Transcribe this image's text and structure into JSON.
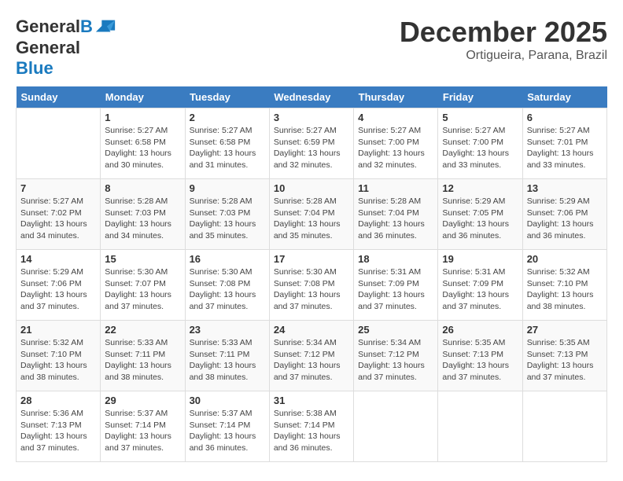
{
  "header": {
    "logo_line1": "General",
    "logo_line2": "Blue",
    "month": "December 2025",
    "location": "Ortigueira, Parana, Brazil"
  },
  "columns": [
    "Sunday",
    "Monday",
    "Tuesday",
    "Wednesday",
    "Thursday",
    "Friday",
    "Saturday"
  ],
  "weeks": [
    [
      {
        "day": "",
        "info": ""
      },
      {
        "day": "1",
        "info": "Sunrise: 5:27 AM\nSunset: 6:58 PM\nDaylight: 13 hours and 30 minutes."
      },
      {
        "day": "2",
        "info": "Sunrise: 5:27 AM\nSunset: 6:58 PM\nDaylight: 13 hours and 31 minutes."
      },
      {
        "day": "3",
        "info": "Sunrise: 5:27 AM\nSunset: 6:59 PM\nDaylight: 13 hours and 32 minutes."
      },
      {
        "day": "4",
        "info": "Sunrise: 5:27 AM\nSunset: 7:00 PM\nDaylight: 13 hours and 32 minutes."
      },
      {
        "day": "5",
        "info": "Sunrise: 5:27 AM\nSunset: 7:00 PM\nDaylight: 13 hours and 33 minutes."
      },
      {
        "day": "6",
        "info": "Sunrise: 5:27 AM\nSunset: 7:01 PM\nDaylight: 13 hours and 33 minutes."
      }
    ],
    [
      {
        "day": "7",
        "info": "Sunrise: 5:27 AM\nSunset: 7:02 PM\nDaylight: 13 hours and 34 minutes."
      },
      {
        "day": "8",
        "info": "Sunrise: 5:28 AM\nSunset: 7:03 PM\nDaylight: 13 hours and 34 minutes."
      },
      {
        "day": "9",
        "info": "Sunrise: 5:28 AM\nSunset: 7:03 PM\nDaylight: 13 hours and 35 minutes."
      },
      {
        "day": "10",
        "info": "Sunrise: 5:28 AM\nSunset: 7:04 PM\nDaylight: 13 hours and 35 minutes."
      },
      {
        "day": "11",
        "info": "Sunrise: 5:28 AM\nSunset: 7:04 PM\nDaylight: 13 hours and 36 minutes."
      },
      {
        "day": "12",
        "info": "Sunrise: 5:29 AM\nSunset: 7:05 PM\nDaylight: 13 hours and 36 minutes."
      },
      {
        "day": "13",
        "info": "Sunrise: 5:29 AM\nSunset: 7:06 PM\nDaylight: 13 hours and 36 minutes."
      }
    ],
    [
      {
        "day": "14",
        "info": "Sunrise: 5:29 AM\nSunset: 7:06 PM\nDaylight: 13 hours and 37 minutes."
      },
      {
        "day": "15",
        "info": "Sunrise: 5:30 AM\nSunset: 7:07 PM\nDaylight: 13 hours and 37 minutes."
      },
      {
        "day": "16",
        "info": "Sunrise: 5:30 AM\nSunset: 7:08 PM\nDaylight: 13 hours and 37 minutes."
      },
      {
        "day": "17",
        "info": "Sunrise: 5:30 AM\nSunset: 7:08 PM\nDaylight: 13 hours and 37 minutes."
      },
      {
        "day": "18",
        "info": "Sunrise: 5:31 AM\nSunset: 7:09 PM\nDaylight: 13 hours and 37 minutes."
      },
      {
        "day": "19",
        "info": "Sunrise: 5:31 AM\nSunset: 7:09 PM\nDaylight: 13 hours and 37 minutes."
      },
      {
        "day": "20",
        "info": "Sunrise: 5:32 AM\nSunset: 7:10 PM\nDaylight: 13 hours and 38 minutes."
      }
    ],
    [
      {
        "day": "21",
        "info": "Sunrise: 5:32 AM\nSunset: 7:10 PM\nDaylight: 13 hours and 38 minutes."
      },
      {
        "day": "22",
        "info": "Sunrise: 5:33 AM\nSunset: 7:11 PM\nDaylight: 13 hours and 38 minutes."
      },
      {
        "day": "23",
        "info": "Sunrise: 5:33 AM\nSunset: 7:11 PM\nDaylight: 13 hours and 38 minutes."
      },
      {
        "day": "24",
        "info": "Sunrise: 5:34 AM\nSunset: 7:12 PM\nDaylight: 13 hours and 37 minutes."
      },
      {
        "day": "25",
        "info": "Sunrise: 5:34 AM\nSunset: 7:12 PM\nDaylight: 13 hours and 37 minutes."
      },
      {
        "day": "26",
        "info": "Sunrise: 5:35 AM\nSunset: 7:13 PM\nDaylight: 13 hours and 37 minutes."
      },
      {
        "day": "27",
        "info": "Sunrise: 5:35 AM\nSunset: 7:13 PM\nDaylight: 13 hours and 37 minutes."
      }
    ],
    [
      {
        "day": "28",
        "info": "Sunrise: 5:36 AM\nSunset: 7:13 PM\nDaylight: 13 hours and 37 minutes."
      },
      {
        "day": "29",
        "info": "Sunrise: 5:37 AM\nSunset: 7:14 PM\nDaylight: 13 hours and 37 minutes."
      },
      {
        "day": "30",
        "info": "Sunrise: 5:37 AM\nSunset: 7:14 PM\nDaylight: 13 hours and 36 minutes."
      },
      {
        "day": "31",
        "info": "Sunrise: 5:38 AM\nSunset: 7:14 PM\nDaylight: 13 hours and 36 minutes."
      },
      {
        "day": "",
        "info": ""
      },
      {
        "day": "",
        "info": ""
      },
      {
        "day": "",
        "info": ""
      }
    ]
  ]
}
